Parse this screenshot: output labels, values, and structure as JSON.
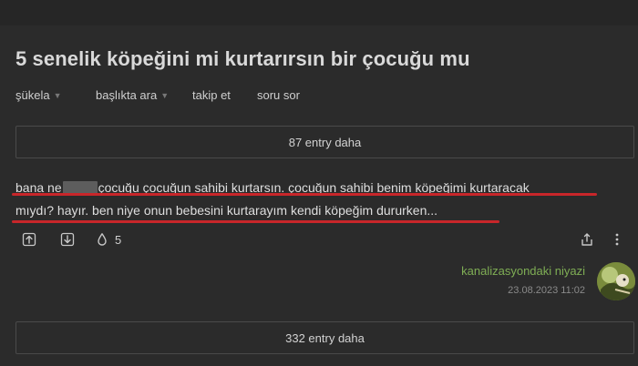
{
  "topic": {
    "title": "5 senelik köpeğini mi kurtarırsın bir çocuğu mu"
  },
  "subnav": {
    "sukela": "şükela",
    "baslikta_ara": "başlıkta ara",
    "takip_et": "takip et",
    "soru_sor": "soru sor"
  },
  "more_top": {
    "label": "87 entry daha"
  },
  "entry": {
    "text_before_redaction": "bana ne",
    "text_line1_rest": "çocuğu çocuğun sahibi kurtarsın. çocuğun sahibi benim köpeğimi kurtaracak",
    "text_line2": "mıydı? hayır. ben niye onun bebesini kurtarayım kendi köpeğim dururken...",
    "favorite_count": "5",
    "author": "kanalizasyondaki niyazi",
    "date": "23.08.2023 11:02",
    "highlight_color": "#c8262a"
  },
  "more_bottom": {
    "label": "332 entry daha"
  },
  "icons": {
    "upvote": "upvote-icon",
    "downvote": "downvote-icon",
    "favorite": "drop-icon",
    "share": "share-icon",
    "more": "more-vertical-icon"
  }
}
